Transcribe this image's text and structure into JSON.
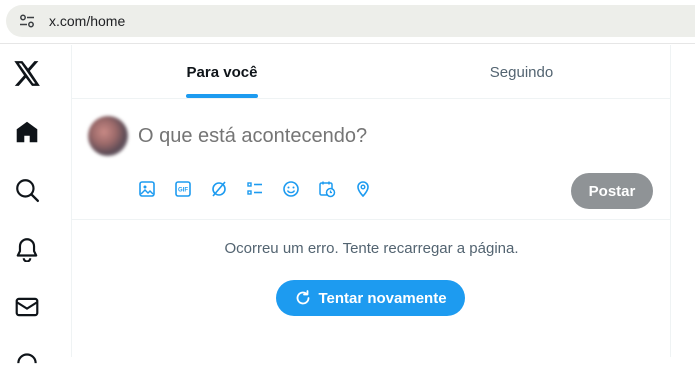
{
  "browser": {
    "url": "x.com/home"
  },
  "sidebar": {
    "items": [
      {
        "icon": "x-logo-icon"
      },
      {
        "icon": "home-icon"
      },
      {
        "icon": "search-icon"
      },
      {
        "icon": "notifications-bell-icon"
      },
      {
        "icon": "messages-envelope-icon"
      }
    ]
  },
  "tabs": [
    {
      "label": "Para você",
      "active": true
    },
    {
      "label": "Seguindo",
      "active": false
    }
  ],
  "compose": {
    "placeholder": "O que está acontecendo?",
    "tools": [
      "media-image-icon",
      "gif-icon",
      "grok-icon",
      "poll-list-icon",
      "emoji-icon",
      "schedule-icon",
      "location-pin-icon"
    ],
    "gif_text": "GIF",
    "post_label": "Postar"
  },
  "feed": {
    "error_message": "Ocorreu um erro. Tente recarregar a página.",
    "retry_label": "Tentar novamente"
  },
  "colors": {
    "accent": "#1d9bf0",
    "post_disabled": "#8f9396",
    "secondary_text": "#536471"
  }
}
